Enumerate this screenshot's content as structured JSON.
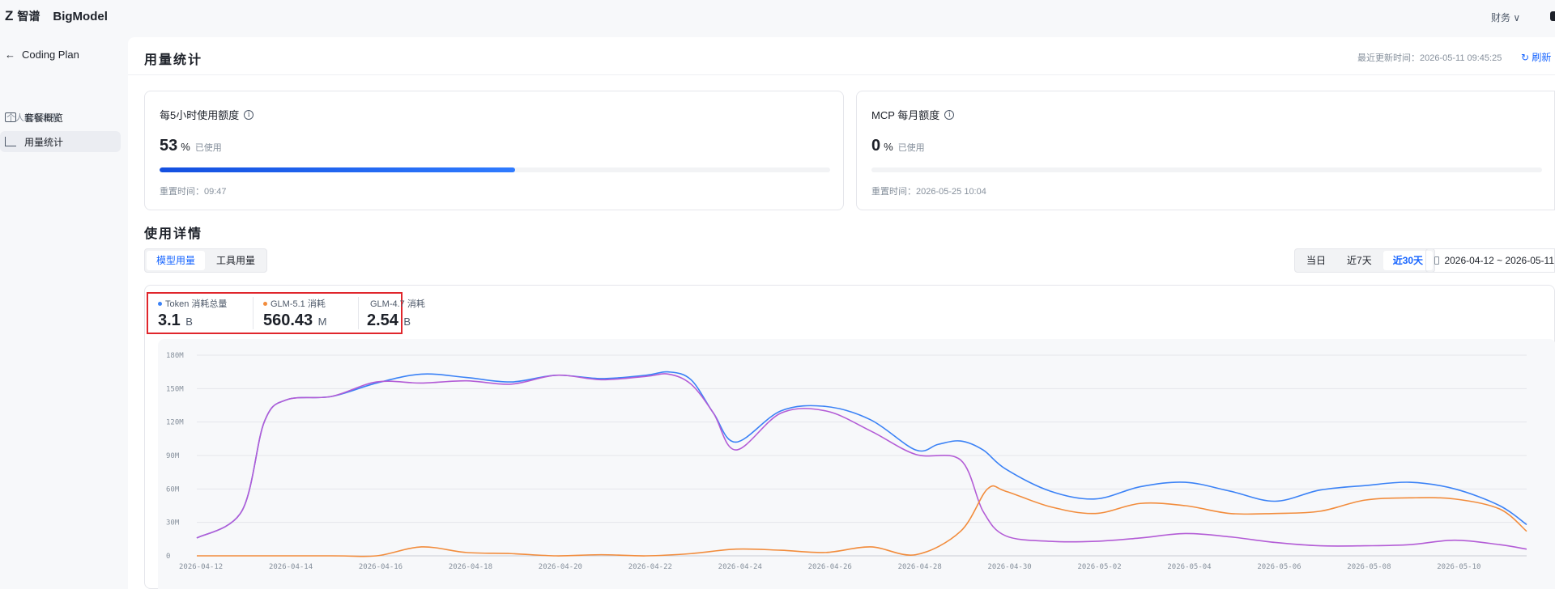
{
  "topbar": {
    "logo_cn": "智谱",
    "logo_en": "BigModel",
    "finance": "财务 ∨"
  },
  "sidebar": {
    "back_label": "Coding Plan",
    "group": "个人编程套餐",
    "items": [
      {
        "label": "套餐概览",
        "icon": "monitor-icon",
        "active": false
      },
      {
        "label": "用量统计",
        "icon": "chart-icon",
        "active": true
      }
    ]
  },
  "header": {
    "title": "用量统计",
    "updated": "最近更新时间：2026-05-11 09:45:25",
    "refresh": "刷新"
  },
  "quota_cards": [
    {
      "title": "每5小时使用额度",
      "percent": "53",
      "unit": "%",
      "used": "已使用",
      "fill": 0.53,
      "reset": "重置时间：09:47"
    },
    {
      "title": "MCP 每月额度",
      "percent": "0",
      "unit": "%",
      "used": "已使用",
      "fill": 0,
      "reset": "重置时间：2026-05-25 10:04"
    }
  ],
  "details": {
    "title": "使用详情",
    "tabs": [
      {
        "label": "模型用量",
        "active": true
      },
      {
        "label": "工具用量",
        "active": false
      }
    ],
    "ranges": [
      {
        "label": "当日",
        "active": false
      },
      {
        "label": "近7天",
        "active": false
      },
      {
        "label": "近30天",
        "active": true
      }
    ],
    "date_range": "2026-04-12 ~ 2026-05-11"
  },
  "stats": [
    {
      "label": "Token 消耗总量",
      "value": "3.1",
      "unit": "B",
      "color": "#3b82f6"
    },
    {
      "label": "GLM-5.1 消耗",
      "value": "560.43",
      "unit": "M",
      "color": "#f28c3c"
    },
    {
      "label": "GLM-4.7 消耗",
      "value": "2.54",
      "unit": "B",
      "color": "#b35cd6"
    }
  ],
  "chart_data": {
    "type": "line",
    "x_ticks": [
      "2026-04-12",
      "2026-04-14",
      "2026-04-16",
      "2026-04-18",
      "2026-04-20",
      "2026-04-22",
      "2026-04-24",
      "2026-04-26",
      "2026-04-28",
      "2026-04-30",
      "2026-05-02",
      "2026-05-04",
      "2026-05-06",
      "2026-05-08",
      "2026-05-10"
    ],
    "y_ticks": [
      "0",
      "30M",
      "60M",
      "90M",
      "120M",
      "150M",
      "180M"
    ],
    "ylim": [
      0,
      180
    ],
    "grid": true,
    "series": [
      {
        "color": "#3b82f6",
        "x": [
          0,
          1,
          1.5,
          2,
          3,
          4,
          5,
          6,
          7,
          8,
          9,
          10,
          10.5,
          11,
          11.5,
          12,
          13,
          14,
          15,
          16,
          16.5,
          17,
          17.5,
          18,
          19,
          20,
          21,
          22,
          23,
          24,
          25,
          26,
          27,
          28,
          29,
          29.6
        ],
        "values": [
          16,
          40,
          120,
          140,
          143,
          155,
          163,
          160,
          156,
          162,
          159,
          162,
          165,
          158,
          128,
          102,
          130,
          134,
          122,
          95,
          100,
          103,
          95,
          78,
          58,
          51,
          62,
          66,
          58,
          49,
          59,
          63,
          66,
          60,
          45,
          28
        ]
      },
      {
        "color": "#b35cd6",
        "x": [
          0,
          1,
          1.5,
          2,
          3,
          4,
          5,
          6,
          7,
          8,
          9,
          10,
          10.5,
          11,
          11.5,
          12,
          13,
          14,
          15,
          16,
          17,
          17.5,
          18,
          19,
          20,
          21,
          22,
          23,
          24,
          25,
          26,
          27,
          28,
          29,
          29.6
        ],
        "values": [
          16,
          40,
          120,
          140,
          143,
          156,
          155,
          157,
          154,
          162,
          158,
          161,
          163,
          154,
          128,
          95,
          128,
          130,
          112,
          91,
          86,
          40,
          18,
          13,
          13,
          16,
          20,
          17,
          12,
          9,
          9,
          10,
          14,
          10,
          6
        ]
      },
      {
        "color": "#f28c3c",
        "x": [
          0,
          3,
          4,
          5,
          6,
          7,
          8,
          9,
          10,
          11,
          12,
          13,
          14,
          15,
          16,
          17,
          17.6,
          18,
          19,
          20,
          21,
          22,
          23,
          24,
          25,
          26,
          27,
          28,
          29,
          29.6
        ],
        "values": [
          0,
          0,
          0,
          8,
          3,
          2,
          0,
          1,
          0,
          2,
          6,
          5,
          3,
          8,
          1,
          22,
          60,
          58,
          44,
          38,
          47,
          45,
          38,
          38,
          40,
          50,
          52,
          51,
          42,
          22
        ]
      }
    ]
  }
}
